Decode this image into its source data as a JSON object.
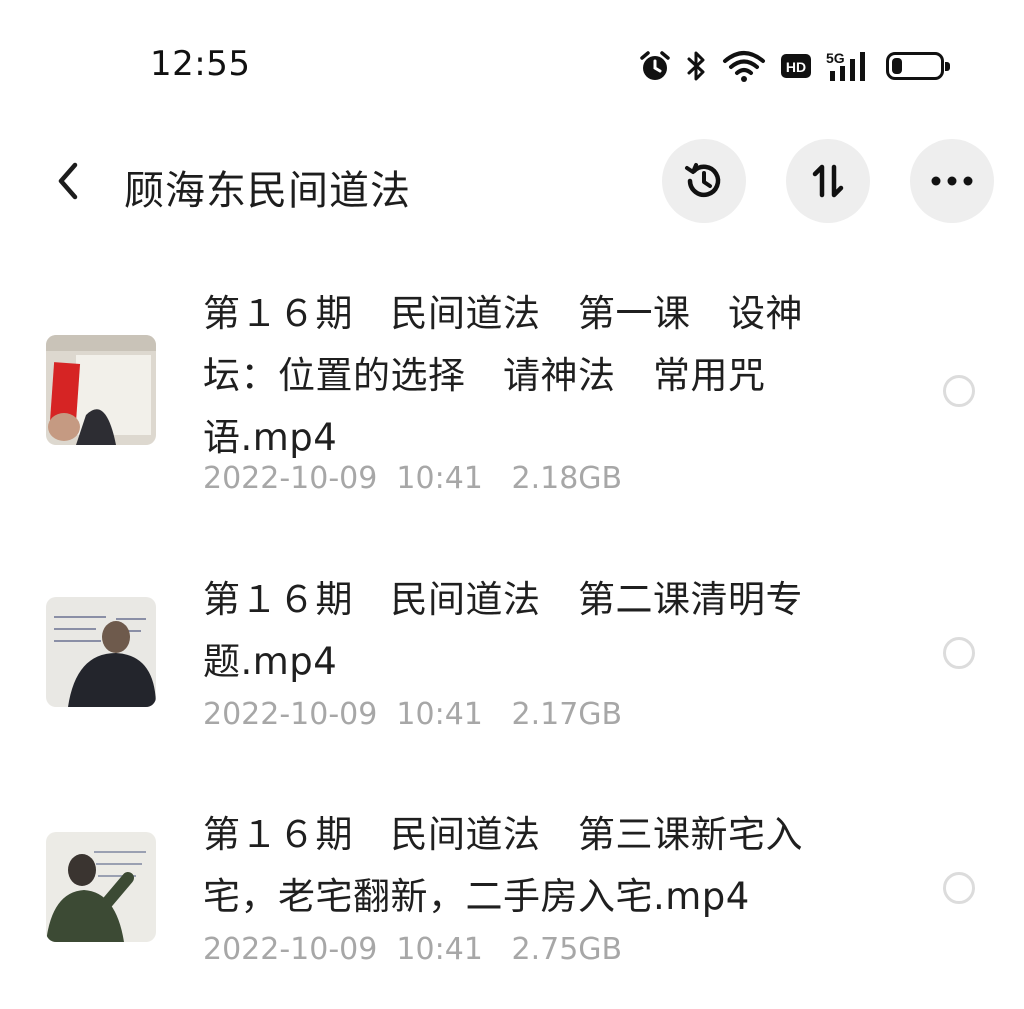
{
  "status_bar": {
    "time": "12:55",
    "icons": [
      "alarm-icon",
      "bluetooth-icon",
      "wifi-icon",
      "hd-icon",
      "5g-signal-icon",
      "battery-icon"
    ],
    "hd_label": "HD",
    "network_label": "5G",
    "battery_level": 0.22
  },
  "header": {
    "title": "顾海东民间道法",
    "buttons": [
      "history-icon",
      "sort-icon",
      "more-icon"
    ]
  },
  "files": [
    {
      "name": "第１６期　民间道法　第一课　设神坛：位置的选择　请神法　常用咒语.mp4",
      "date": "2022-10-09  10:41",
      "size": "2.18GB"
    },
    {
      "name": "第１６期　民间道法　第二课清明专题.mp4",
      "date": "2022-10-09  10:41",
      "size": "2.17GB"
    },
    {
      "name": "第１６期　民间道法　第三课新宅入宅，老宅翻新，二手房入宅.mp4",
      "date": "2022-10-09  10:41",
      "size": "2.75GB"
    }
  ],
  "colors": {
    "text": "#1f1f1f",
    "meta": "#a7a7a7",
    "button_bg": "#eeeeee",
    "radio_border": "#dcdcdc"
  }
}
